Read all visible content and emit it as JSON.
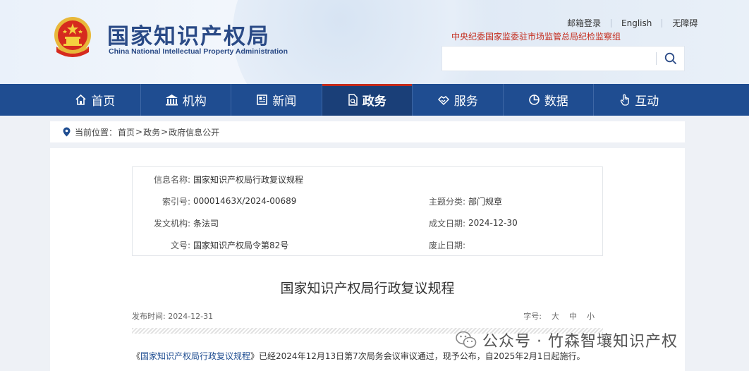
{
  "header": {
    "site_title": "国家知识产权局",
    "site_subtitle": "China National Intellectual Property Administration",
    "top_links": [
      "邮箱登录",
      "English",
      "无障碍"
    ],
    "org_note": "中央纪委国家监委驻市场监管总局纪检监察组",
    "search": {
      "placeholder": ""
    }
  },
  "nav": {
    "items": [
      {
        "label": "首页",
        "icon": "home-icon"
      },
      {
        "label": "机构",
        "icon": "building-icon"
      },
      {
        "label": "新闻",
        "icon": "newspaper-icon"
      },
      {
        "label": "政务",
        "icon": "document-icon",
        "active": true
      },
      {
        "label": "服务",
        "icon": "handshake-icon"
      },
      {
        "label": "数据",
        "icon": "pie-chart-icon"
      },
      {
        "label": "互动",
        "icon": "hand-pointer-icon"
      }
    ]
  },
  "breadcrumb": {
    "prefix": "当前位置：",
    "items": [
      "首页",
      "政务",
      "政府信息公开"
    ],
    "separator": ">"
  },
  "meta": {
    "info_name_label": "信息名称:",
    "info_name": "国家知识产权局行政复议规程",
    "index_label": "索引号:",
    "index": "00001463X/2024-00689",
    "topic_label": "主题分类:",
    "topic": "部门规章",
    "issuer_label": "发文机构:",
    "issuer": "条法司",
    "date_label": "成文日期:",
    "date": "2024-12-30",
    "doc_no_label": "文号:",
    "doc_no": "国家知识产权局令第82号",
    "expiry_label": "废止日期:",
    "expiry": ""
  },
  "article": {
    "title": "国家知识产权局行政复议规程",
    "publish_label": "发布时间:",
    "publish_date": "2024-12-31",
    "font_label": "字号:",
    "font_sizes": [
      "大",
      "中",
      "小"
    ],
    "body_open": "《",
    "body_link": "国家知识产权局行政复议规程",
    "body_rest": "》已经2024年12月13日第7次局务会议审议通过，现予公布，自2025年2月1日起施行。"
  },
  "watermark": {
    "text": "公众号 · 竹森智壤知识产权",
    "icon": "wechat-icon"
  },
  "colors": {
    "nav_bg": "#1f4d91",
    "title_blue": "#2a4a86",
    "accent_red": "#c42b1c"
  }
}
